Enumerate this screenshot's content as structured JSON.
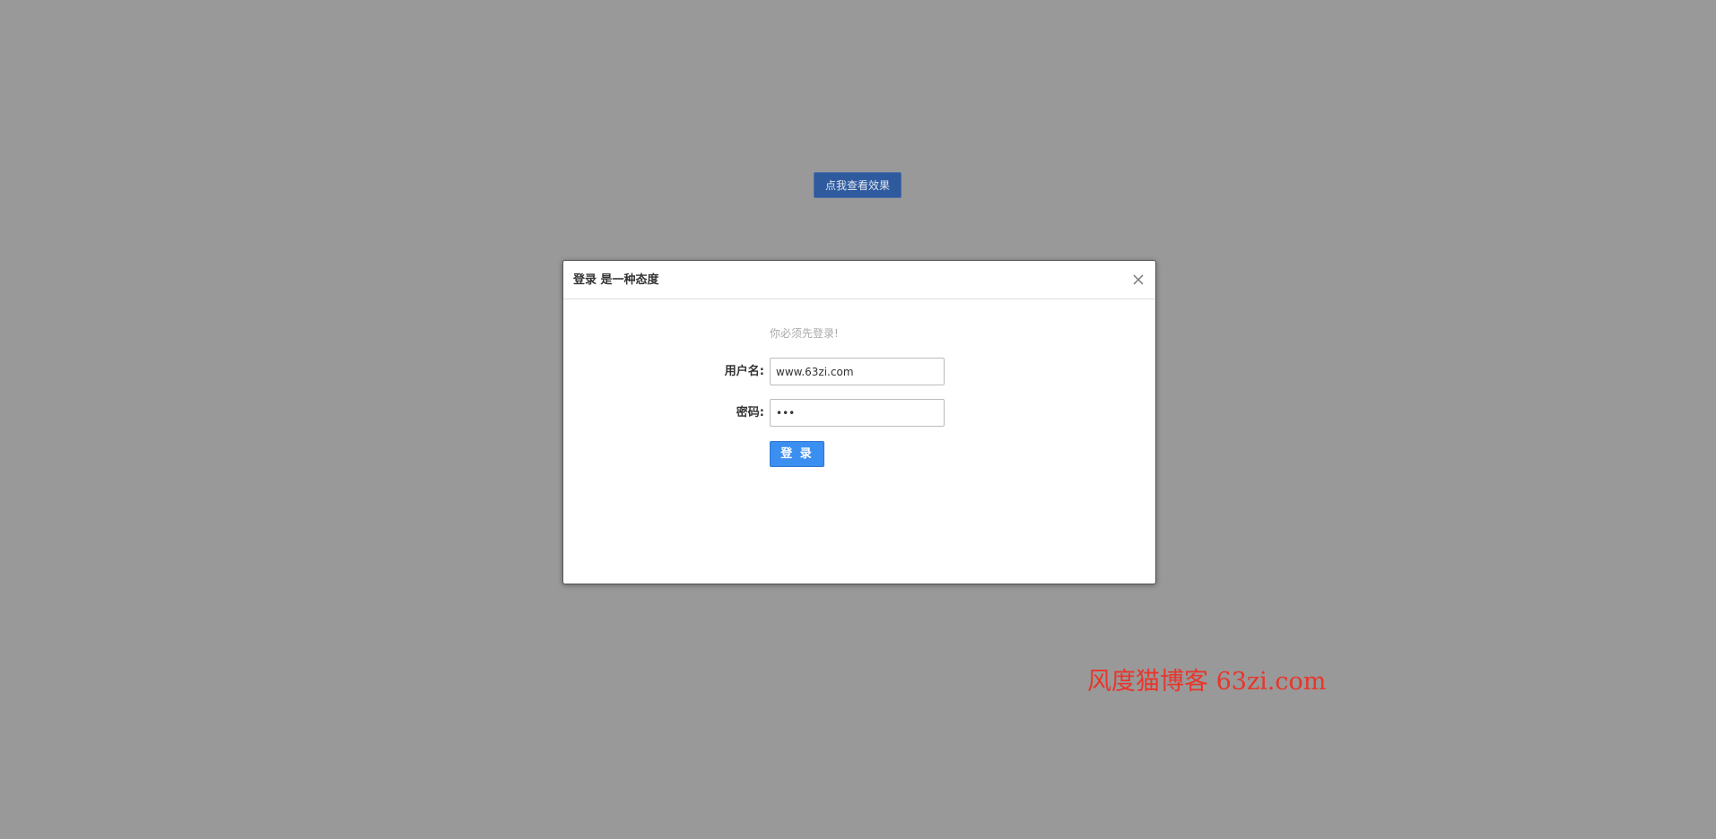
{
  "trigger": {
    "label": "点我查看效果"
  },
  "dialog": {
    "title": "登录 是一种态度",
    "close_icon": "close-icon",
    "hint": "你必须先登录!",
    "username": {
      "label": "用户名:",
      "value": "www.63zi.com"
    },
    "password": {
      "label": "密码:",
      "value": "•••"
    },
    "submit_label": "登 录"
  },
  "watermark": {
    "text": "风度猫博客 63zi.com"
  },
  "colors": {
    "background": "#999999",
    "trigger_button": "#2f5a9e",
    "login_button": "#3b8ff0",
    "watermark": "#e8362b"
  }
}
